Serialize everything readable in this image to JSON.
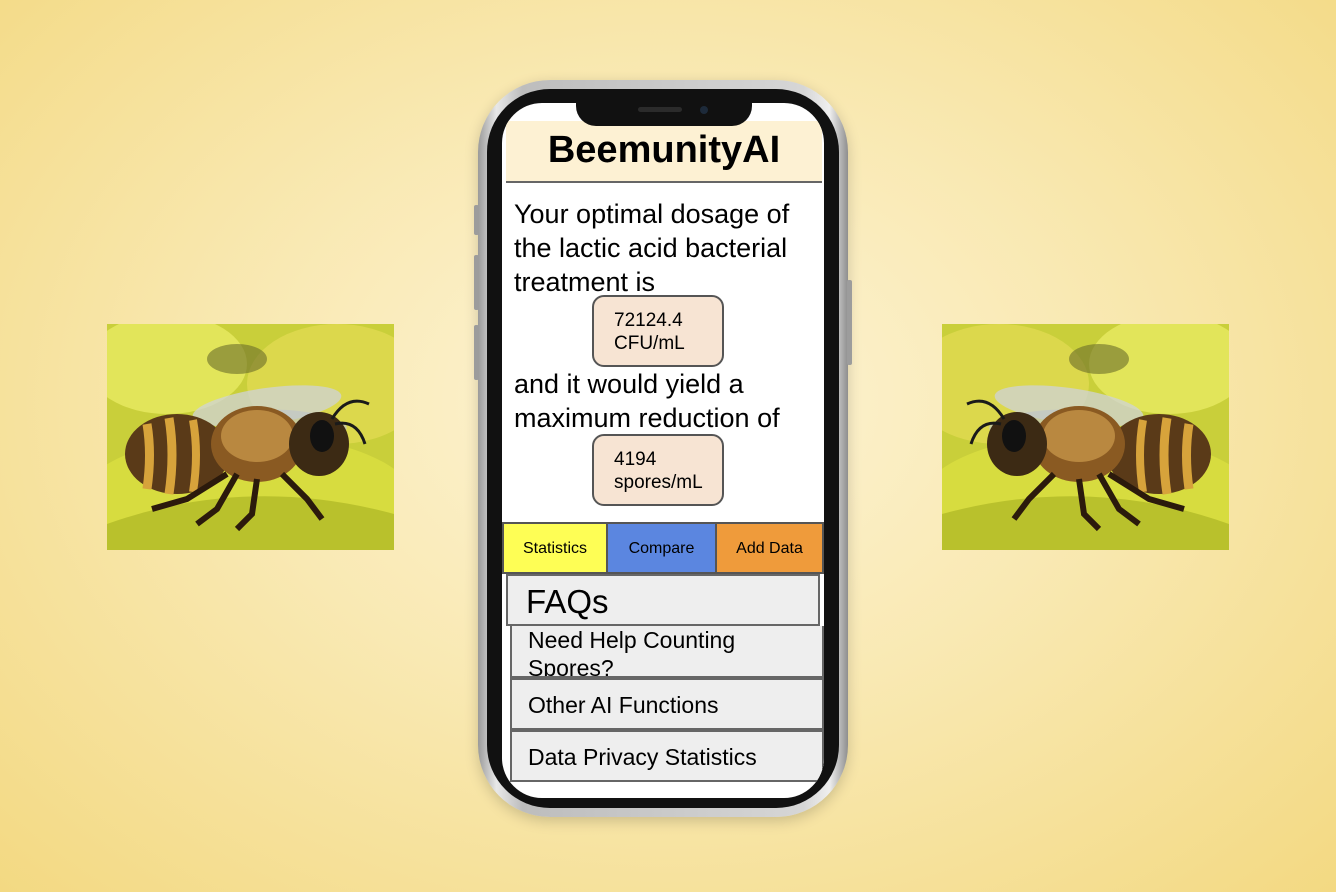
{
  "app": {
    "title": "BeemunityAI"
  },
  "result": {
    "intro": "Your optimal dosage of the lactic acid bacterial treatment is",
    "dosage_value": "72124.4",
    "dosage_unit": "CFU/mL",
    "middle": "and it would yield a maximum reduction of",
    "reduction_value": "4194",
    "reduction_unit": "spores/mL"
  },
  "tabs": [
    {
      "label": "Statistics",
      "color": "#fefe55"
    },
    {
      "label": "Compare",
      "color": "#5b86e0"
    },
    {
      "label": "Add Data",
      "color": "#ef9b3b"
    }
  ],
  "faq": {
    "title": "FAQs",
    "items": [
      {
        "label": "Need Help Counting Spores?"
      },
      {
        "label": "Other AI Functions"
      },
      {
        "label": "Data Privacy Statistics"
      }
    ]
  },
  "colors": {
    "background": "#f9e9b3",
    "header": "#fdf1d3",
    "value_box": "#f7e4d3"
  }
}
